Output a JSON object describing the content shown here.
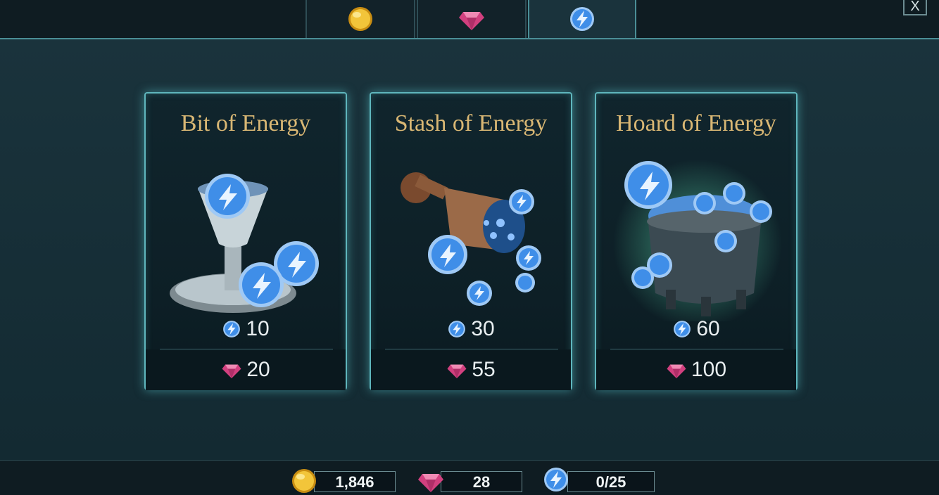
{
  "tabs": [
    {
      "icon": "gold-coin-icon",
      "active": false
    },
    {
      "icon": "gem-icon",
      "active": false
    },
    {
      "icon": "energy-icon",
      "active": true
    }
  ],
  "close_label": "X",
  "offers": [
    {
      "title": "Bit of Energy",
      "amount": "10",
      "price": "20",
      "art": "goblet-with-energy-orbs"
    },
    {
      "title": "Stash of Energy",
      "amount": "30",
      "price": "55",
      "art": "tipped-cup-spilling-energy"
    },
    {
      "title": "Hoard of Energy",
      "amount": "60",
      "price": "100",
      "art": "cauldron-overflowing-energy"
    }
  ],
  "balances": {
    "coins": "1,846",
    "gems": "28",
    "energy": "0/25"
  },
  "colors": {
    "accent": "#5fb6bd",
    "title_gold": "#d9b774",
    "energy_blue": "#3f8ee8",
    "gem_pink": "#e2548f",
    "coin_gold": "#e9b421"
  }
}
